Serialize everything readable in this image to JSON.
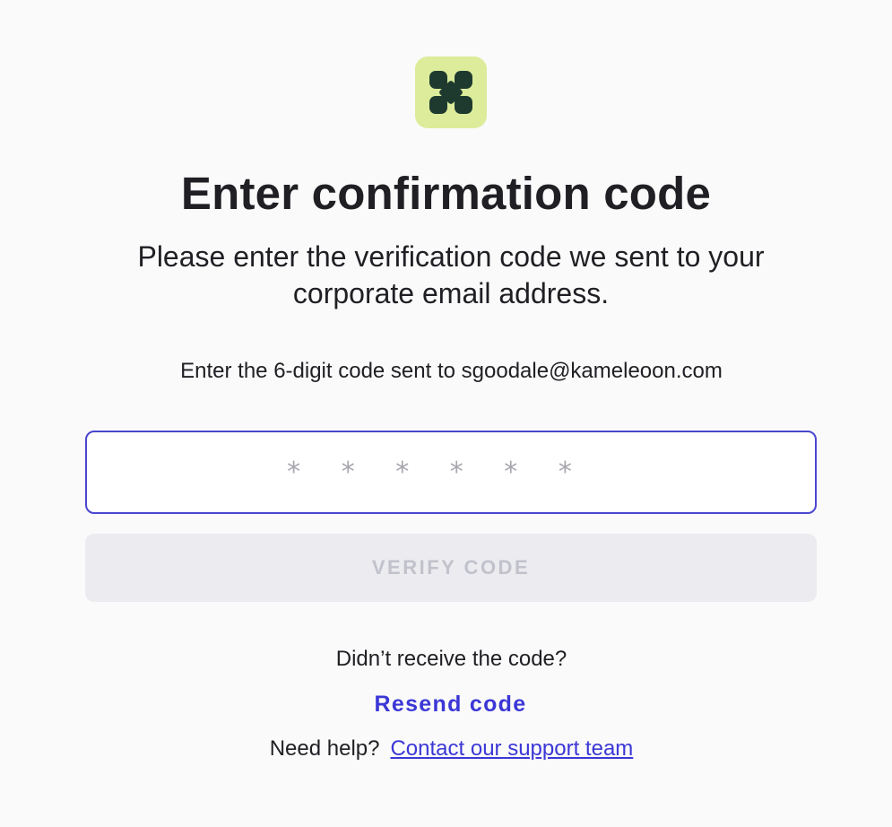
{
  "branding": {
    "logo_icon": "kameleoon-logo-icon",
    "logo_background": "#dcec9a",
    "logo_foreground": "#1e3a2f"
  },
  "header": {
    "title": "Enter confirmation code",
    "subtitle": "Please enter the verification code we sent to your corporate email address."
  },
  "form": {
    "instruction": "Enter the 6-digit code sent to sgoodale@kameleoon.com",
    "code_value": "",
    "code_placeholder": "* * * * * *",
    "verify_label": "VERIFY CODE",
    "verify_disabled": true
  },
  "footer": {
    "didnt_receive": "Didn’t receive the code?",
    "resend_label": "Resend code",
    "need_help": "Need help?",
    "support_link": "Contact our support team"
  },
  "colors": {
    "accent": "#3b37d6",
    "input_border": "#4a46d0",
    "text": "#1f1f24",
    "disabled_bg": "#ebebf0",
    "disabled_text": "#c2c2cc",
    "page_bg": "#fafafa"
  }
}
